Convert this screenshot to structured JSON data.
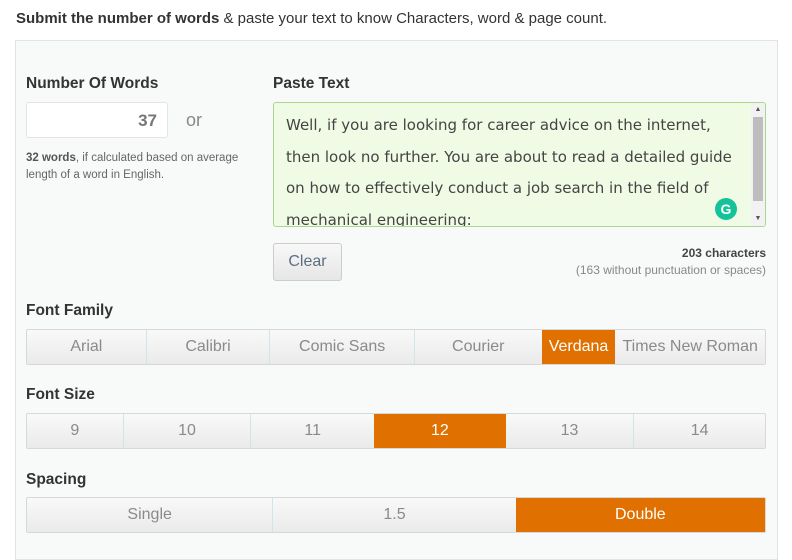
{
  "intro": {
    "bold": "Submit the number of words",
    "rest": " & paste your text to know Characters, word & page count."
  },
  "words": {
    "label": "Number Of Words",
    "value": "37",
    "or": "or",
    "note_bold": "32 words",
    "note_rest": ", if calculated based on average length of a word in English."
  },
  "paste": {
    "label": "Paste Text",
    "text": "Well, if you are looking for career advice on the internet, then look no further. You are about to read a detailed guide on how to effectively conduct a job search in the field of mechanical engineering:",
    "clear": "Clear",
    "characters": "203 characters",
    "without": "(163 without punctuation or spaces)",
    "grammarly_icon": "G"
  },
  "font_family": {
    "label": "Font Family",
    "options": [
      "Arial",
      "Calibri",
      "Comic Sans",
      "Courier",
      "Verdana",
      "Times New Roman"
    ],
    "selected": "Verdana"
  },
  "font_size": {
    "label": "Font Size",
    "options": [
      "9",
      "10",
      "11",
      "12",
      "13",
      "14"
    ],
    "selected": "12"
  },
  "spacing": {
    "label": "Spacing",
    "options": [
      "Single",
      "1.5",
      "Double"
    ],
    "selected": "Double"
  },
  "colors": {
    "accent": "#e07000",
    "textarea_bg": "#f0fbe6",
    "grammarly": "#15c39a"
  }
}
